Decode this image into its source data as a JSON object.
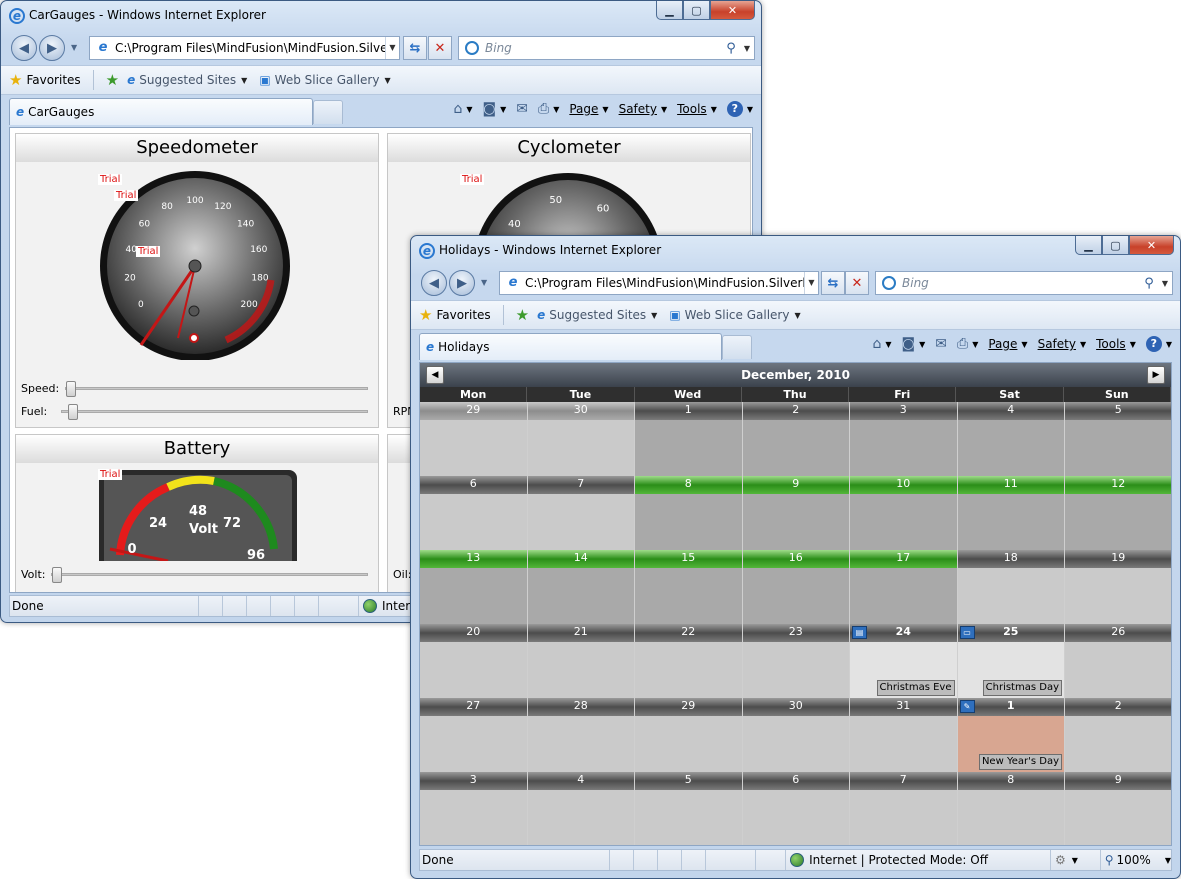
{
  "win1": {
    "title": "CarGauges - Windows Internet Explorer",
    "address": "C:\\Program Files\\MindFusion\\MindFusion.Silverlight",
    "search_placeholder": "Bing",
    "favorites_label": "Favorites",
    "suggested_sites": "Suggested Sites",
    "web_slice": "Web Slice Gallery",
    "tab_label": "CarGauges",
    "cmd": {
      "page": "Page",
      "safety": "Safety",
      "tools": "Tools"
    },
    "status_done": "Done",
    "status_zone": "Internet",
    "speedometer": {
      "title": "Speedometer",
      "trial": "Trial",
      "ticks": [
        "0",
        "20",
        "40",
        "60",
        "80",
        "100",
        "120",
        "140",
        "160",
        "180",
        "200"
      ],
      "speed_label": "Speed:",
      "fuel_label": "Fuel:",
      "speed_value": 0,
      "fuel_value": 0.02
    },
    "cyclometer": {
      "title": "Cyclometer",
      "trial": "Trial",
      "ticks": [
        "40",
        "50",
        "60"
      ],
      "rpm_label": "RPM"
    },
    "battery": {
      "title": "Battery",
      "trial": "Trial",
      "ticks": [
        "0",
        "24",
        "48",
        "72",
        "96"
      ],
      "unit": "Volt",
      "volt_label": "Volt:",
      "oil_label": "Oil:"
    }
  },
  "win2": {
    "title": "Holidays - Windows Internet Explorer",
    "address": "C:\\Program Files\\MindFusion\\MindFusion.Silverlight",
    "search_placeholder": "Bing",
    "favorites_label": "Favorites",
    "suggested_sites": "Suggested Sites",
    "web_slice": "Web Slice Gallery",
    "tab_label": "Holidays",
    "cmd": {
      "page": "Page",
      "safety": "Safety",
      "tools": "Tools"
    },
    "status_done": "Done",
    "status_zone": "Internet | Protected Mode: Off",
    "zoom": "100%",
    "calendar": {
      "month": "December, 2010",
      "prev": "◀",
      "next": "▶",
      "weekdays": [
        "Mon",
        "Tue",
        "Wed",
        "Thu",
        "Fri",
        "Sat",
        "Sun"
      ],
      "weeks": [
        [
          "29",
          "30",
          "1",
          "2",
          "3",
          "4",
          "5"
        ],
        [
          "6",
          "7",
          "8",
          "9",
          "10",
          "11",
          "12"
        ],
        [
          "13",
          "14",
          "15",
          "16",
          "17",
          "18",
          "19"
        ],
        [
          "20",
          "21",
          "22",
          "23",
          "24",
          "25",
          "26"
        ],
        [
          "27",
          "28",
          "29",
          "30",
          "31",
          "1",
          "2"
        ],
        [
          "3",
          "4",
          "5",
          "6",
          "7",
          "8",
          "9"
        ]
      ],
      "events": {
        "christmas_eve": "Christmas Eve",
        "christmas_day": "Christmas Day",
        "new_year": "New Year's Day"
      }
    }
  }
}
